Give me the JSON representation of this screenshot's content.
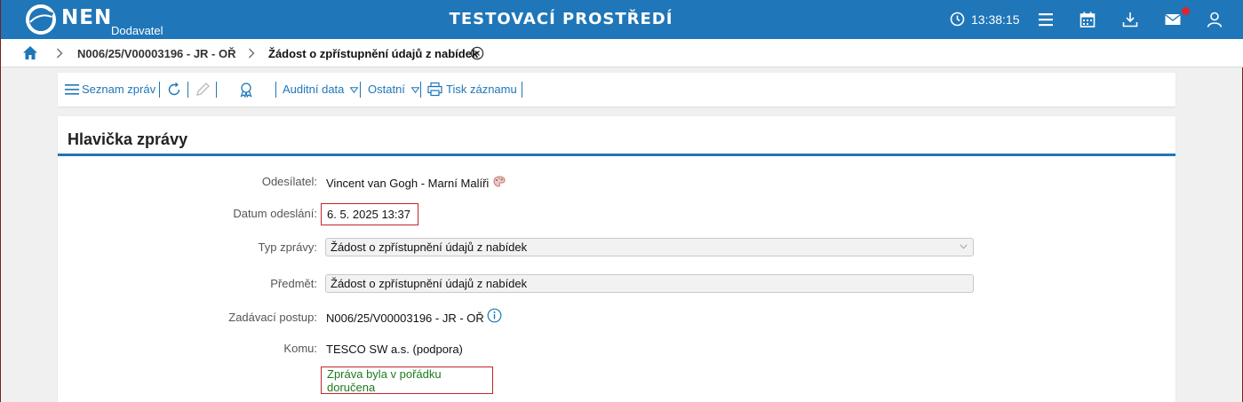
{
  "topbar": {
    "brand": "NEN",
    "brand_sub": "Dodavatel",
    "env_title": "TESTOVACÍ PROSTŘEDÍ",
    "clock_time": "13:38:15",
    "icons": [
      "clock-icon",
      "menu-icon",
      "calendar-icon",
      "download-icon",
      "mail-icon",
      "user-icon"
    ],
    "notification_color": "#e0242b",
    "brand_color": "#1f76b8"
  },
  "breadcrumb": {
    "items": [
      "N006/25/V00003196 - JR - OŘ",
      "Žádost o zpřístupnění údajů z nabídek"
    ]
  },
  "toolbar": {
    "message_list": "Seznam zpráv",
    "audit_data": "Auditní data",
    "other": "Ostatní",
    "print_record": "Tisk záznamu"
  },
  "panel": {
    "title": "Hlavička zprávy",
    "sender_label": "Odesílatel:",
    "sender_value": "Vincent van Gogh - Marní Malíři",
    "sent_date_label": "Datum odeslání:",
    "sent_date_value": "6. 5. 2025 13:37",
    "message_type_label": "Typ zprávy:",
    "message_type_value": "Žádost o zpřístupnění údajů z nabídek",
    "subject_label": "Předmět:",
    "subject_value": "Žádost o zpřístupnění údajů z nabídek",
    "procedure_label": "Zadávací postup:",
    "procedure_value": "N006/25/V00003196 - JR - OŘ",
    "recipient_label": "Komu:",
    "recipient_value": "TESCO SW a.s. (podpora)",
    "delivery_status": "Zpráva byla v pořádku doručena",
    "delivery_color": "#1e7a1e",
    "highlight_color": "#c0262b"
  }
}
